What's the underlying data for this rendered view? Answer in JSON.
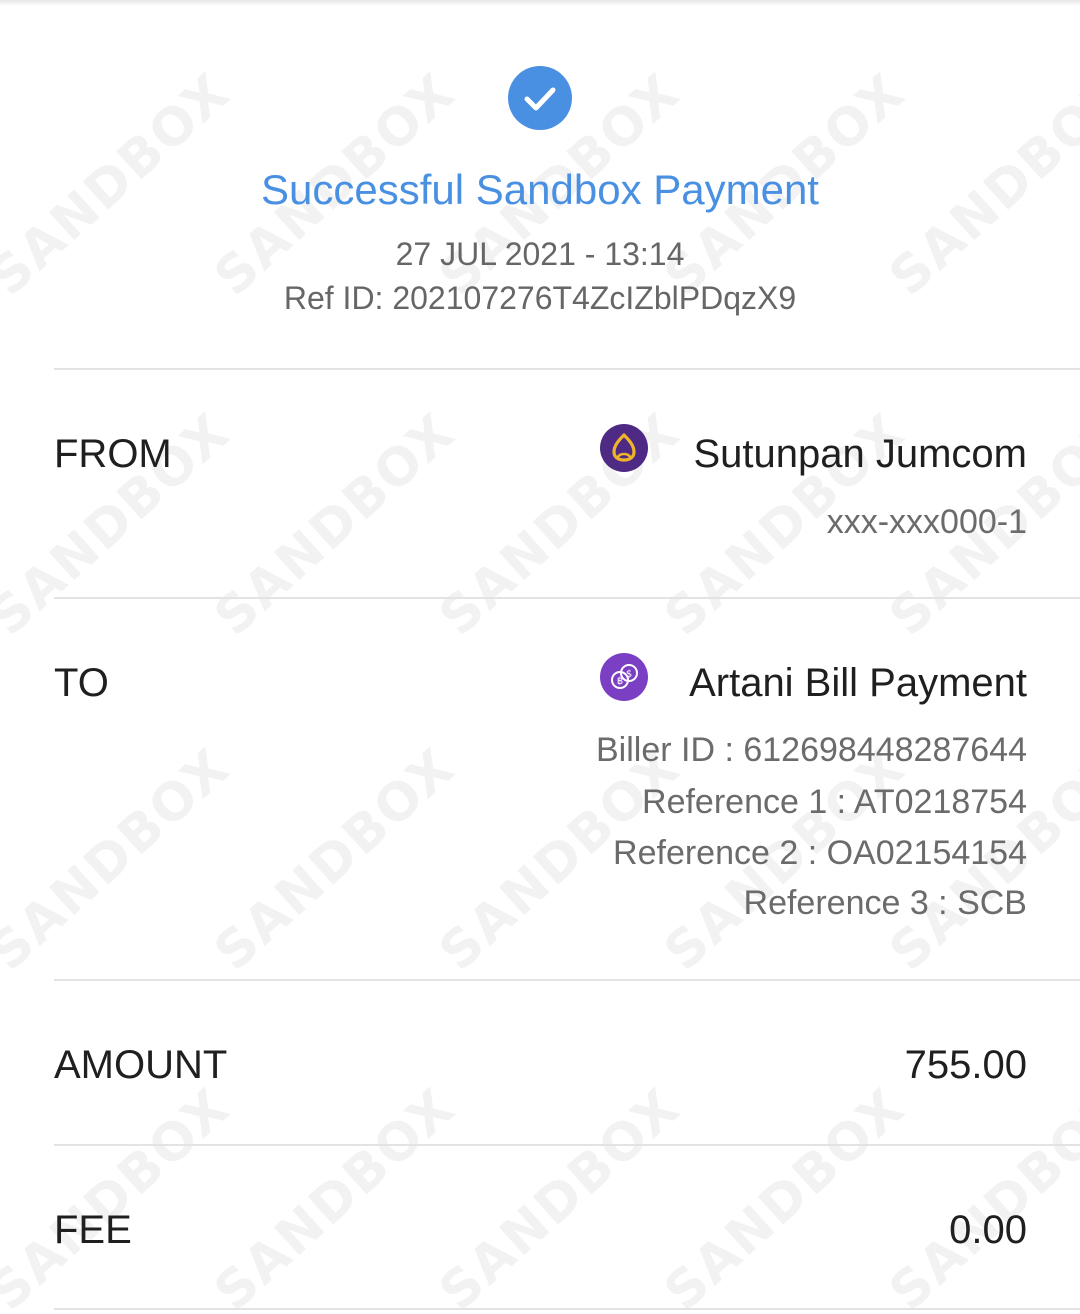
{
  "header": {
    "status_title": "Successful Sandbox Payment",
    "datetime": "27 JUL 2021 - 13:14",
    "ref_id": "Ref ID: 202107276T4ZcIZblPDqzX9"
  },
  "watermark": {
    "text": "SANDBOX"
  },
  "from": {
    "label": "FROM",
    "name": "Sutunpan Jumcom",
    "account": "xxx-xxx000-1",
    "logo_icon": "scb-bank-icon",
    "logo_color": "#4e2a84"
  },
  "to": {
    "label": "TO",
    "name": "Artani Bill Payment",
    "biller_id": "Biller ID : 612698448287644",
    "reference_1": "Reference 1 : AT0218754",
    "reference_2": "Reference 2 : OA02154154",
    "reference_3": "Reference 3 : SCB",
    "logo_icon": "bill-payment-icon",
    "logo_color": "#7b3fc4"
  },
  "amount": {
    "label": "AMOUNT",
    "value": "755.00"
  },
  "fee": {
    "label": "FEE",
    "value": "0.00"
  },
  "colors": {
    "accent": "#4a90e2",
    "text_primary": "#1f1f1f",
    "text_secondary": "#6b6b6b",
    "divider": "#e3e3e3"
  }
}
